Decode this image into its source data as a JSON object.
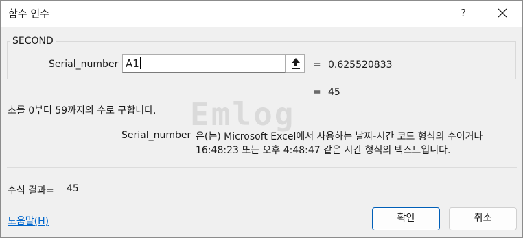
{
  "window": {
    "title": "함수 인수",
    "help_label": "?"
  },
  "function": {
    "name": "SECOND",
    "description": "초를 0부터 59까지의 수로 구합니다."
  },
  "argument": {
    "name": "Serial_number",
    "value": "A1",
    "evaluated": "0.625520833"
  },
  "equals": "=",
  "formula_result_preview": "45",
  "argument_help": {
    "name": "Serial_number",
    "text": "은(는) Microsoft Excel에서 사용하는 날짜-시간 코드 형식의 수이거나 16:48:23 또는 오후 4:48:47 같은 시간 형식의 텍스트입니다."
  },
  "result": {
    "label": "수식 결과=",
    "value": "45"
  },
  "help_link": "도움말(H)",
  "buttons": {
    "ok": "확인",
    "cancel": "취소"
  },
  "watermark": "Emlog",
  "icons": {
    "close": "close-icon",
    "collapse": "collapse-dialog-icon"
  }
}
